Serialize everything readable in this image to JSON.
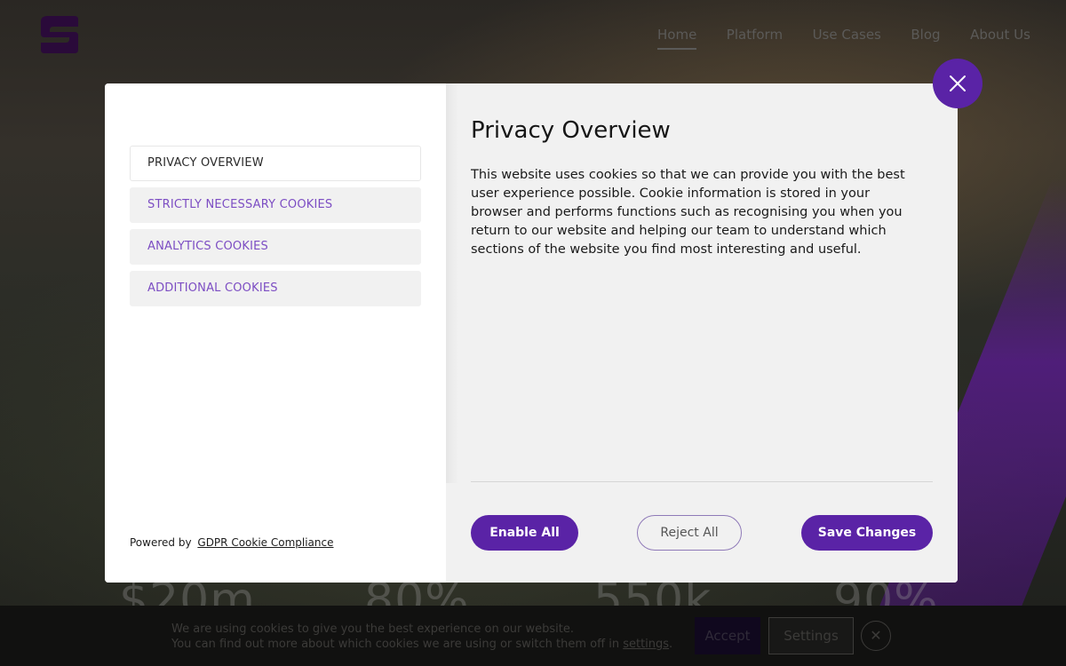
{
  "site": {
    "nav": [
      "Home",
      "Platform",
      "Use Cases",
      "Blog",
      "About Us"
    ],
    "stats": [
      "$20m",
      "80%",
      "550k",
      "90%"
    ]
  },
  "cookie_bar": {
    "line1": "We are using cookies to give you the best experience on our website.",
    "line2_prefix": "You can find out more about which cookies we are using or switch them off in ",
    "settings_link": "settings",
    "line2_suffix": ".",
    "accept_label": "Accept",
    "settings_label": "Settings"
  },
  "modal": {
    "tabs": [
      "PRIVACY OVERVIEW",
      "STRICTLY NECESSARY COOKIES",
      "ANALYTICS COOKIES",
      "ADDITIONAL COOKIES"
    ],
    "powered_by": "Powered by",
    "powered_link": "GDPR Cookie Compliance",
    "title": "Privacy Overview",
    "body": "This website uses cookies so that we can provide you with the best user experience possible. Cookie information is stored in your browser and performs functions such as recognising you when you return to our website and helping our team to understand which sections of the website you find most interesting and useful.",
    "enable_all": "Enable All",
    "reject_all": "Reject All",
    "save_changes": "Save Changes"
  },
  "colors": {
    "accent": "#5a23a6",
    "tab_text": "#7c4dc3",
    "panel_bg": "#f1f1f1"
  },
  "icons": {
    "logo": "s-logo",
    "modal_close": "close-icon",
    "bar_close": "close-icon"
  }
}
